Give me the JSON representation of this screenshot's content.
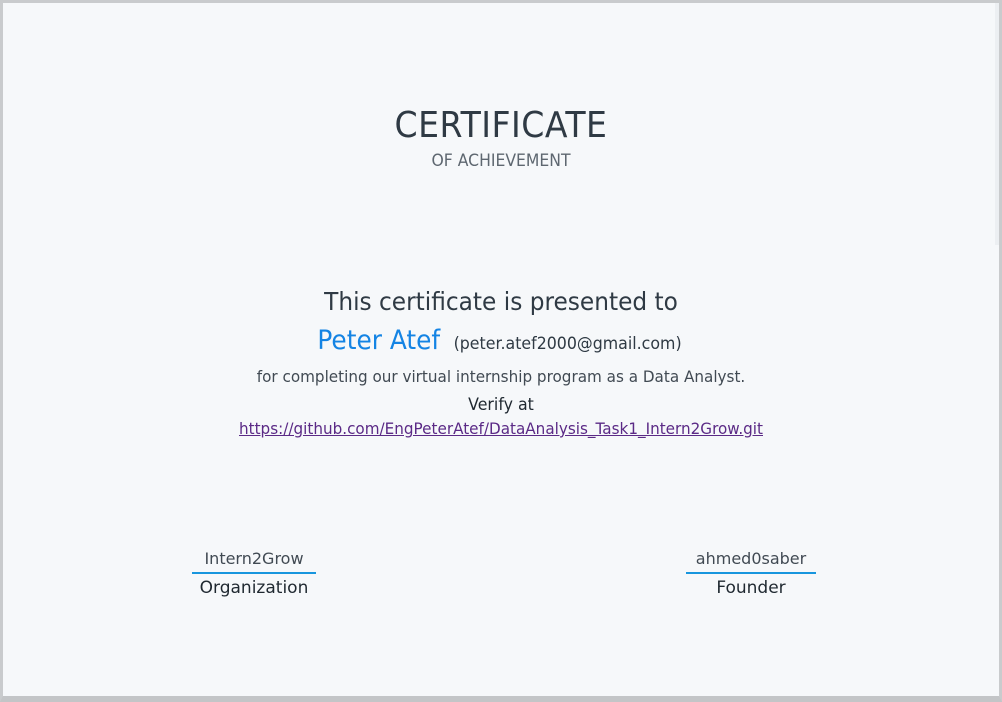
{
  "certificate": {
    "title": "CERTIFICATE",
    "subtitle": "OF ACHIEVEMENT",
    "presented_to": "This certificate is presented to",
    "recipient_name": "Peter Atef",
    "recipient_email": "(peter.atef2000@gmail.com)",
    "description": "for completing our virtual internship program as a Data Analyst.",
    "verify_label": "Verify at",
    "verify_url": "https://github.com/EngPeterAtef/DataAnalysis_Task1_Intern2Grow.git"
  },
  "signatures": {
    "left": {
      "name": "Intern2Grow",
      "role": "Organization"
    },
    "right": {
      "name": "ahmed0saber",
      "role": "Founder"
    }
  },
  "colors": {
    "name_accent": "#1484e4",
    "signature_line": "#1896de",
    "link": "#5b2a86",
    "page_background": "#f6f8fa"
  }
}
